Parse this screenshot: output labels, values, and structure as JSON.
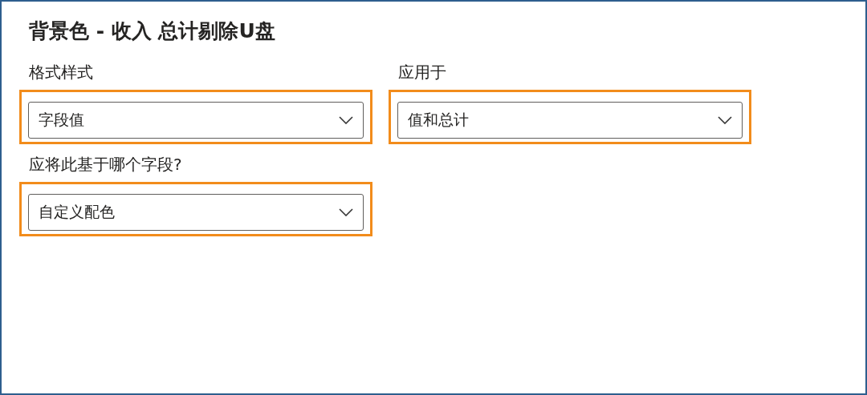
{
  "title": "背景色 - 收入 总计剔除U盘",
  "fields": [
    {
      "label": "格式样式",
      "value": "字段值",
      "highlighted": true
    },
    {
      "label": "应用于",
      "value": "值和总计",
      "highlighted": true
    },
    {
      "label": "应将此基于哪个字段?",
      "value": "自定义配色",
      "highlighted": true
    }
  ]
}
